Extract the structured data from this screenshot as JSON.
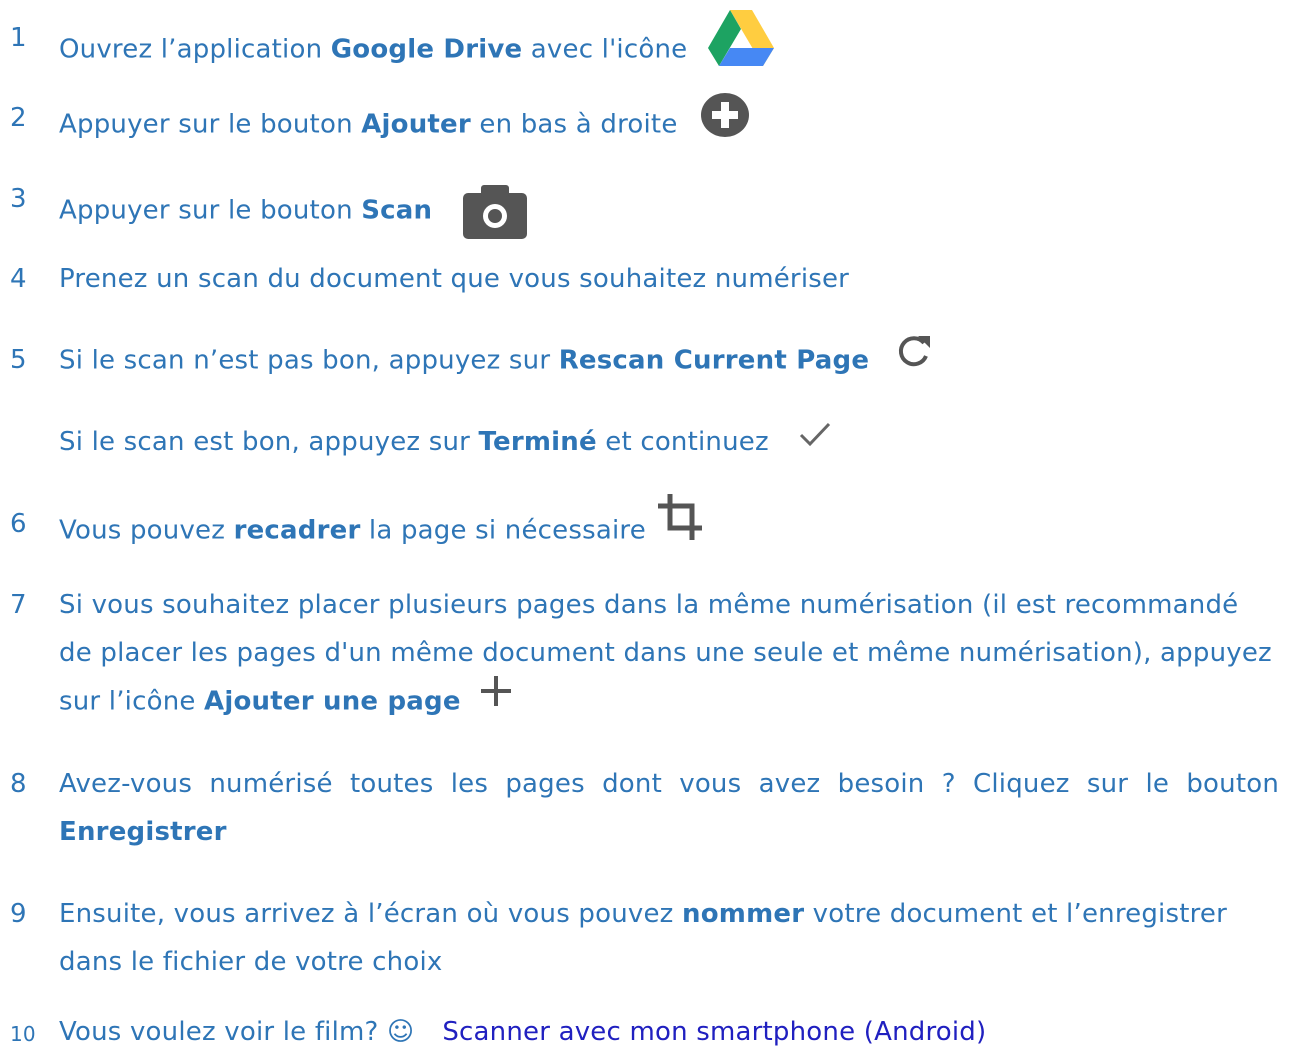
{
  "steps": [
    {
      "num": "1",
      "before": "Ouvrez l’application ",
      "bold": "Google Drive",
      "after": " avec l'icône",
      "icon": "google-drive-icon"
    },
    {
      "num": "2",
      "before": "Appuyer sur le bouton ",
      "bold": "Ajouter",
      "after": " en bas à droite",
      "icon": "plus-circle-icon"
    },
    {
      "num": "3",
      "before": "Appuyer sur le bouton ",
      "bold": "Scan",
      "after": "",
      "icon": "camera-icon"
    },
    {
      "num": "4",
      "text": "Prenez un scan du document que vous souhaitez numériser"
    },
    {
      "num": "5",
      "before": "Si le scan n’est pas bon, appuyez sur ",
      "bold": "Rescan Current Page",
      "after": "",
      "icon": "refresh-icon",
      "sub_before": "Si le scan est bon, appuyez sur ",
      "sub_bold": "Terminé",
      "sub_after": " et continuez",
      "sub_icon": "checkmark-icon"
    },
    {
      "num": "6",
      "before": "Vous pouvez ",
      "bold": "recadrer",
      "after": " la page si nécessaire",
      "icon": "crop-icon"
    },
    {
      "num": "7",
      "before": "Si vous souhaitez placer plusieurs pages dans la même numérisation (il est recommandé de placer les pages d'un même document dans une seule et même numérisation), appuyez sur l’icône ",
      "bold": "Ajouter une page",
      "after": "",
      "icon": "plus-icon"
    },
    {
      "num": "8",
      "before": "Avez-vous numérisé toutes les pages dont vous avez besoin ? Cliquez sur le bouton ",
      "bold": "Enregistrer",
      "after": ""
    },
    {
      "num": "9",
      "before": "Ensuite, vous arrivez à l’écran où vous pouvez ",
      "bold": "nommer",
      "after": " votre document et l’enregistrer dans le fichier de votre choix"
    },
    {
      "num": "10",
      "before": "Vous voulez voir le film? ☺",
      "link": "Scanner avec mon smartphone (Android)"
    }
  ],
  "colors": {
    "text": "#2e75b6",
    "link": "#2020c0",
    "icon_gray": "#555555",
    "drive_green": "#1da362",
    "drive_yellow": "#ffcd40",
    "drive_blue": "#4688f4"
  }
}
